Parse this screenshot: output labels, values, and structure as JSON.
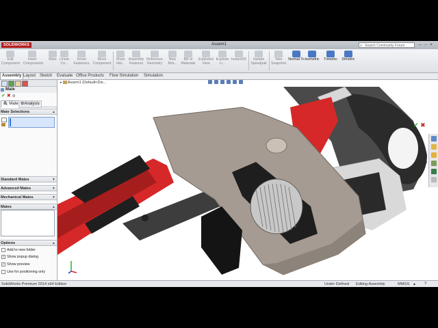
{
  "window": {
    "logo_brand": "SOLIDWORKS",
    "document_title": "Assem1",
    "search_placeholder": "Search Community Forum"
  },
  "ribbon": {
    "buttons": [
      {
        "label": "Edit Component",
        "active": false
      },
      {
        "label": "Insert Components",
        "active": false
      },
      {
        "label": "Mate",
        "active": false
      },
      {
        "label": "Linear Co...",
        "active": false
      },
      {
        "label": "Smart Fasteners",
        "active": false
      },
      {
        "label": "Move Component",
        "active": false
      },
      {
        "label": "Show Hid...",
        "active": false
      },
      {
        "label": "Assembly Features",
        "active": false
      },
      {
        "label": "Reference Geometry",
        "active": false
      },
      {
        "label": "New Mot...",
        "active": false
      },
      {
        "label": "Bill of Materials",
        "active": false
      },
      {
        "label": "Exploded View",
        "active": false
      },
      {
        "label": "Explode Li...",
        "active": false
      },
      {
        "label": "Instant3D",
        "active": false
      },
      {
        "label": "Update Speedpak",
        "active": false
      },
      {
        "label": "Take Snapshot",
        "active": false
      },
      {
        "label": "Normal To",
        "active": true
      },
      {
        "label": "Isometric",
        "active": true
      },
      {
        "label": "Trimetric",
        "active": true
      },
      {
        "label": "Dimetric",
        "active": true
      }
    ]
  },
  "tabs": [
    "Assembly",
    "Layout",
    "Sketch",
    "Evaluate",
    "Office Products",
    "Flow Simulation",
    "Simulation"
  ],
  "active_tab": "Assembly",
  "property_manager": {
    "title": "Mate",
    "subtabs": [
      "Mates",
      "Analysis"
    ],
    "groups": {
      "mate_selections": "Mate Selections",
      "standard_mates": "Standard Mates",
      "advanced_mates": "Advanced Mates",
      "mechanical_mates": "Mechanical Mates",
      "mates": "Mates",
      "options": "Options"
    },
    "options": [
      {
        "label": "Add to new folder",
        "checked": false
      },
      {
        "label": "Show popup dialog",
        "checked": true
      },
      {
        "label": "Show preview",
        "checked": true
      },
      {
        "label": "Use for positioning only",
        "checked": false
      }
    ]
  },
  "viewport": {
    "tree_root": "Assem1 (Default<Dis..."
  },
  "statusbar": {
    "product": "SolidWorks Premium 2014 x64 Edition",
    "state": "Under Defined",
    "mode": "Editing Assembly",
    "units": "MMGS"
  },
  "colors": {
    "accent": "#4a78c4",
    "handle_red": "#d62828",
    "steel": "#a59b92"
  }
}
